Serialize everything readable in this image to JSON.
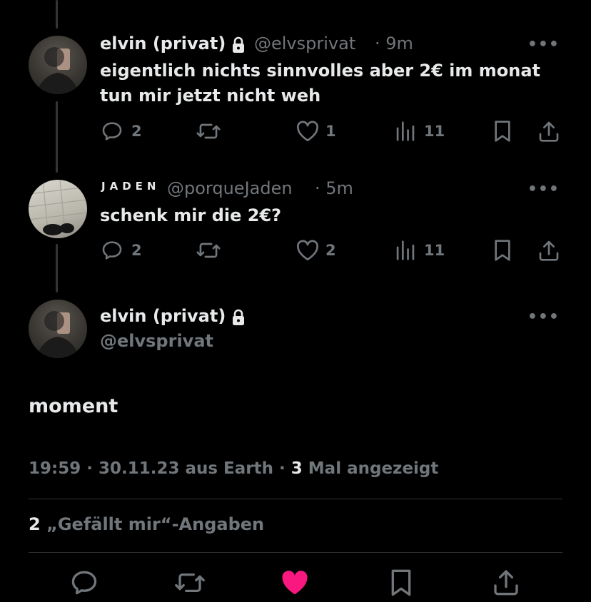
{
  "replies": [
    {
      "name": "elvin (privat)",
      "handle": "@elvsprivat",
      "time": "· 9m",
      "text_line1": "eigentlich nichts sinnvolles aber 2€ im monat",
      "text_line2": "tun mir jetzt nicht weh",
      "replies_count": "2",
      "likes_count": "1",
      "views_count": "11"
    },
    {
      "name": "JADEN",
      "handle": "@porqueJaden",
      "time": "· 5m",
      "text_line1": "schenk mir die 2€?",
      "replies_count": "2",
      "likes_count": "2",
      "views_count": "11"
    }
  ],
  "main_post": {
    "name": "elvin (privat)",
    "handle": "@elvsprivat",
    "text": "moment",
    "time_date": "19:59 · 30.11.23 aus Earth ·",
    "views_number": "3",
    "views_label": "Mal angezeigt",
    "likes_number": "2",
    "likes_label": "„Gefällt mir“-Angaben"
  },
  "more_glyph": "•••",
  "colors": {
    "background": "#000000",
    "text": "#e7e9ea",
    "muted": "#71767b",
    "like_active": "#f91880",
    "divider": "#2f3336"
  }
}
